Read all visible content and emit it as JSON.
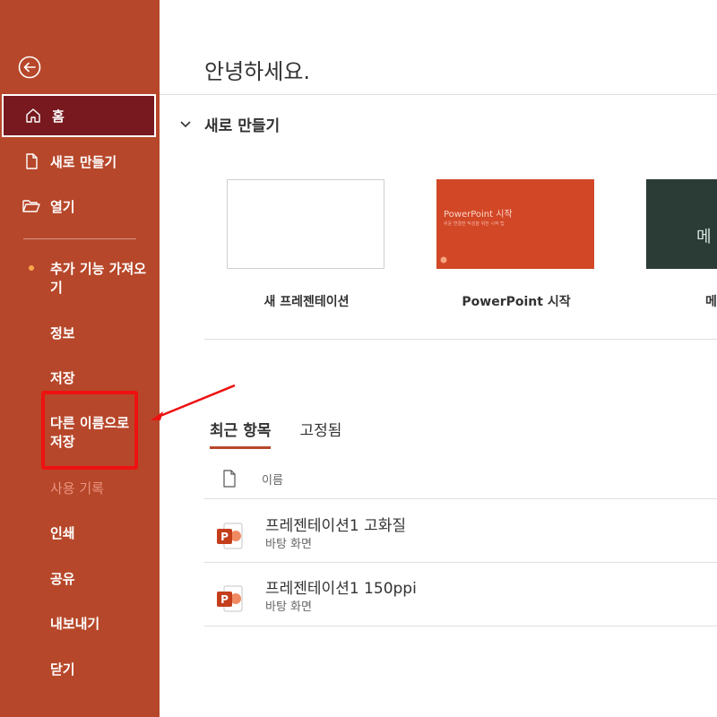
{
  "sidebar": {
    "nav": [
      {
        "label": "홈",
        "icon": "home-icon"
      },
      {
        "label": "새로 만들기",
        "icon": "new-file-icon"
      },
      {
        "label": "열기",
        "icon": "folder-open-icon"
      }
    ],
    "get_addins": "추가 기능 가져오기",
    "info": "정보",
    "save": "저장",
    "save_as": "다른 이름으로 저장",
    "history": "사용 기록",
    "print": "인쇄",
    "share": "공유",
    "export": "내보내기",
    "close": "닫기"
  },
  "main": {
    "greeting": "안녕하세요.",
    "new_section": "새로 만들기",
    "templates": [
      {
        "caption": "새 프레젠테이션"
      },
      {
        "caption": "PowerPoint 시작",
        "thumb_title": "PowerPoint 시작",
        "thumb_sub": "쉬운 연결한 작성을 위한 시작 팁"
      },
      {
        "caption": "메",
        "thumb_title": "메"
      }
    ],
    "tabs": [
      "최근 항목",
      "고정됨"
    ],
    "list_header": "이름",
    "files": [
      {
        "name": "프레젠테이션1 고화질",
        "location": "바탕 화면"
      },
      {
        "name": "프레젠테이션1 150ppi",
        "location": "바탕 화면"
      }
    ]
  },
  "colors": {
    "sidebar_bg": "#b7472a",
    "active_bg": "#77191f",
    "annotation": "#ee1111"
  }
}
